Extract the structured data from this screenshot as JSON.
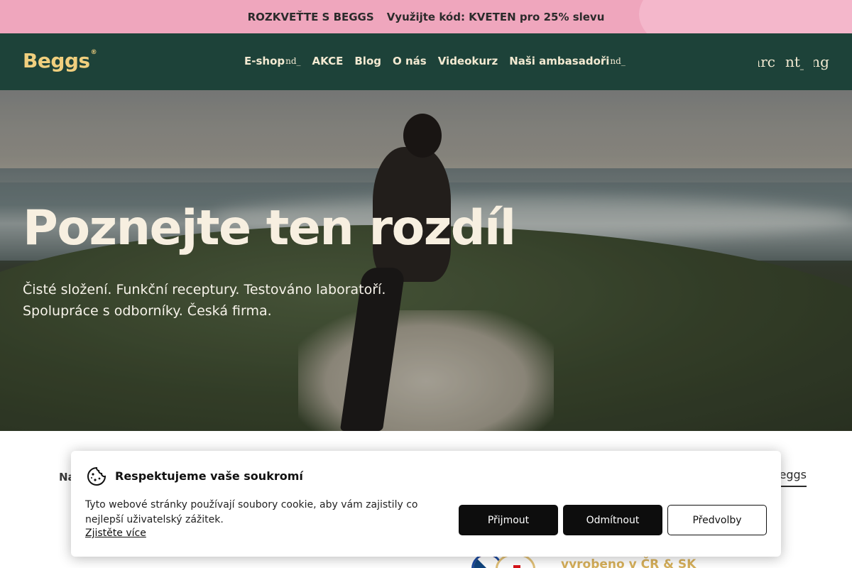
{
  "promo": {
    "headline": "ROZKVEŤTE S BEGGS",
    "offer": "Využijte kód: KVETEN pro 25% slevu"
  },
  "header": {
    "logo": "Beggs",
    "nav": [
      {
        "label": "E-shop",
        "glitch": "nd_"
      },
      {
        "label": "AKCE",
        "glitch": ""
      },
      {
        "label": "Blog",
        "glitch": ""
      },
      {
        "label": "O nás",
        "glitch": ""
      },
      {
        "label": "Videokurz",
        "glitch": ""
      },
      {
        "label": "Naši ambasadoři",
        "glitch": "nd_"
      }
    ],
    "icons": {
      "search": "arc",
      "account": "nt_",
      "cart": "ing"
    }
  },
  "hero": {
    "title": "Poznejte ten rozdíl",
    "subtitle_line1": "Čisté složení. Funkční receptury. Testováno laboratoří.",
    "subtitle_line2": "Spolupráce s odborníky. Česká firma."
  },
  "below": {
    "left_fragment": "Na",
    "right_fragment": "eggs",
    "made_in": "vyrobeno v ČR & SK"
  },
  "cookie": {
    "title": "Respektujeme vaše soukromí",
    "text": "Tyto webové stránky používají soubory cookie, aby vám zajistily co nejlepší uživatelský zážitek.",
    "link": "Zjistěte více",
    "accept": "Přijmout",
    "reject": "Odmítnout",
    "preferences": "Předvolby"
  },
  "colors": {
    "promo_bg": "#efa6bd",
    "header_bg": "#1d4239",
    "logo": "#f0cf7e",
    "button_dark": "#0d0d0d"
  }
}
